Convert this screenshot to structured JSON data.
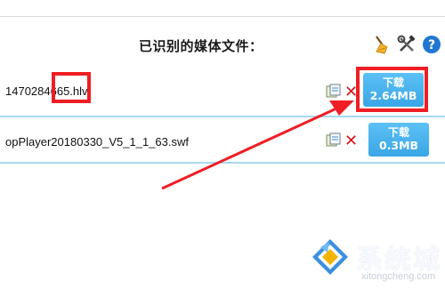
{
  "header": {
    "title": "已识别的媒体文件："
  },
  "tools": [
    {
      "name": "broom-icon"
    },
    {
      "name": "tools-icon"
    },
    {
      "name": "help-icon",
      "label": "?"
    }
  ],
  "files": [
    {
      "name": "1470284665.hlv",
      "button_line1": "下载",
      "button_line2": "2.64MB"
    },
    {
      "name": "opPlayer20180330_V5_1_1_63.swf",
      "button_line1": "下载",
      "button_line2": "0.3MB"
    }
  ],
  "watermark": {
    "brand": "系统城",
    "url": "xitongcheng.com"
  },
  "colors": {
    "accent_blue": "#3aa6e6",
    "annotation_red": "#ef1e24",
    "divider": "#a9d8f2"
  }
}
